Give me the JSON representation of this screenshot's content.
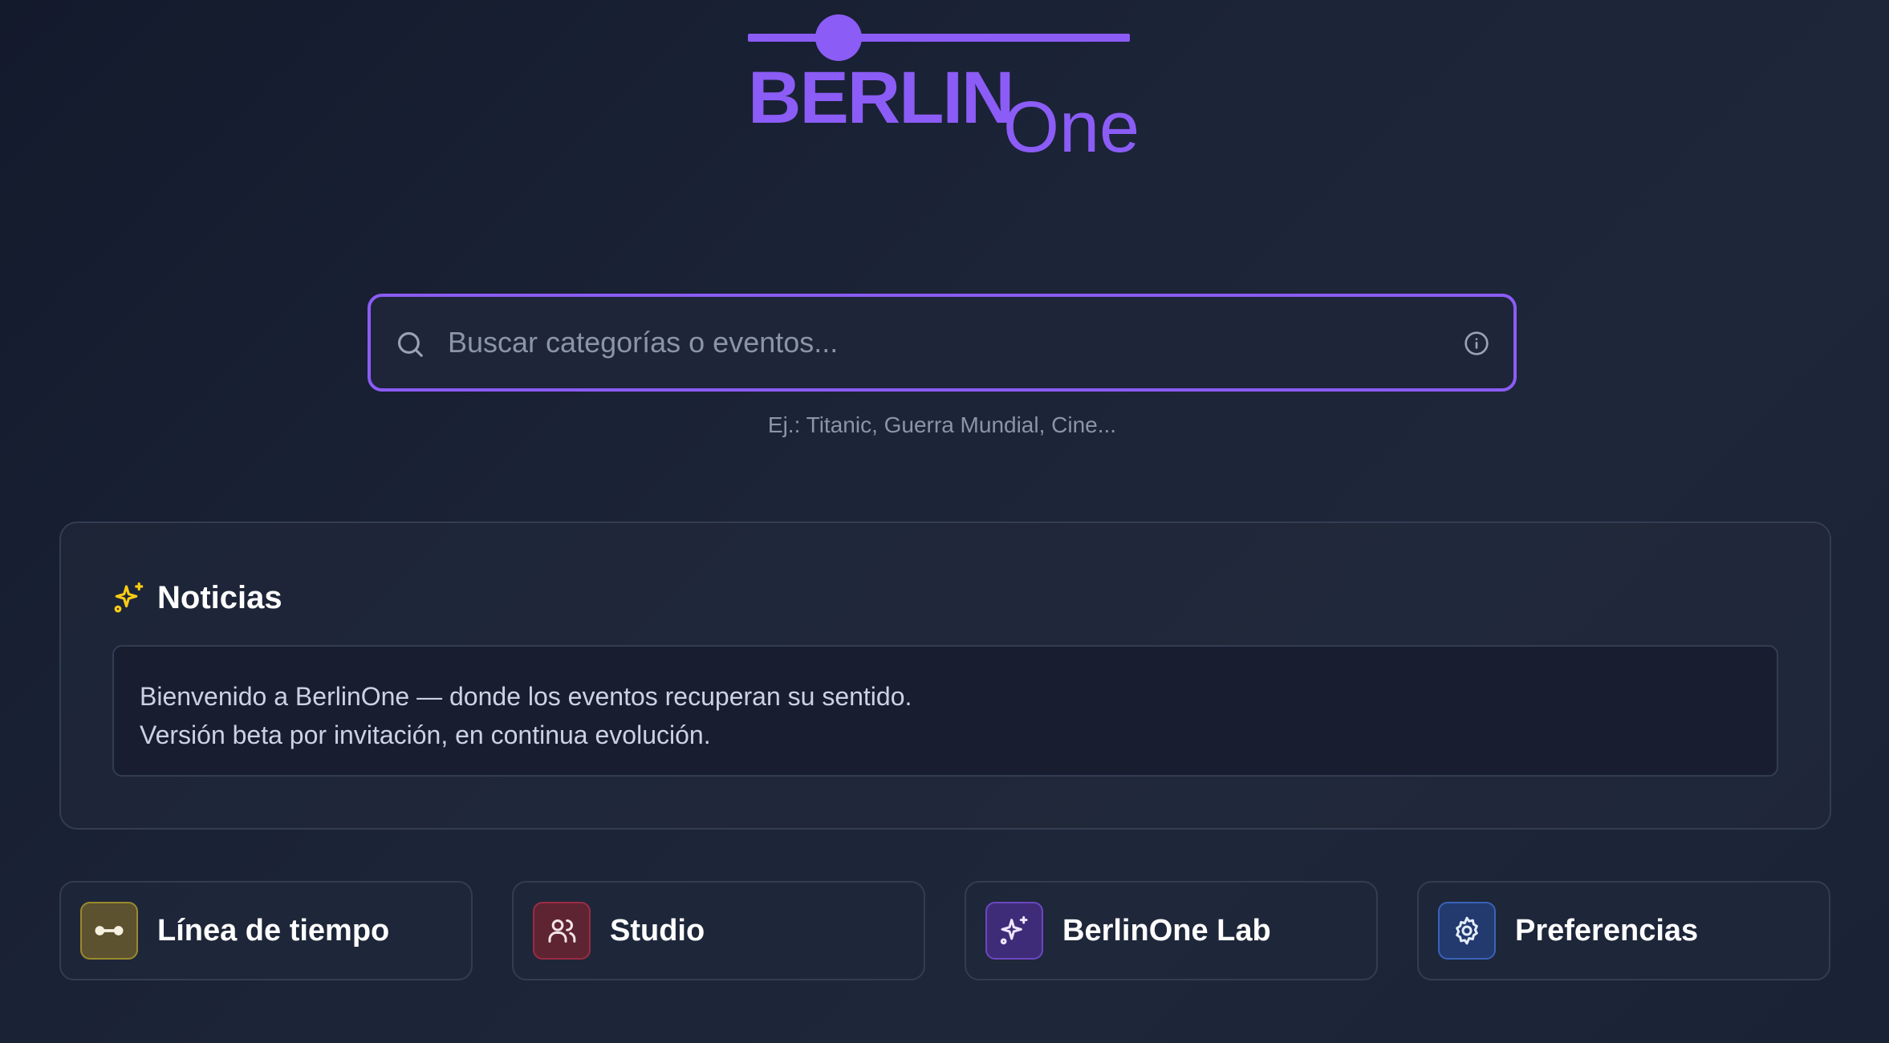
{
  "brand": {
    "name_primary": "BERLIN",
    "name_secondary": "One",
    "color": "#8b5cf6"
  },
  "search": {
    "placeholder": "Buscar categorías o eventos...",
    "value": "",
    "hint": "Ej.: Titanic, Guerra Mundial, Cine...",
    "icon": "search-icon",
    "info_icon": "info-icon"
  },
  "news": {
    "icon": "sparkles-icon",
    "title": "Noticias",
    "lines": [
      "Bienvenido a BerlinOne — donde los eventos recuperan su sentido.",
      "Versión beta por invitación, en continua evolución."
    ]
  },
  "nav": [
    {
      "label": "Línea de tiempo",
      "icon": "timeline-icon",
      "color": "#eab308"
    },
    {
      "label": "Studio",
      "icon": "users-icon",
      "color": "#e11d48"
    },
    {
      "label": "BerlinOne Lab",
      "icon": "sparkles-icon",
      "color": "#8b5cf6"
    },
    {
      "label": "Preferencias",
      "icon": "gear-icon",
      "color": "#3b82f6"
    }
  ],
  "colors": {
    "accent": "#8b5cf6",
    "sparkle": "#facc15",
    "text_muted": "#8b95a8"
  }
}
